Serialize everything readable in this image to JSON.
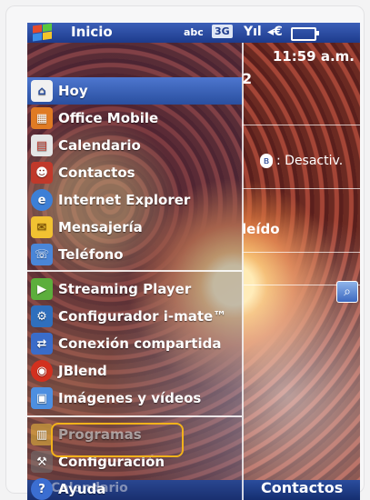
{
  "status_bar": {
    "title": "Inicio",
    "input_mode": "abc",
    "network": "3G"
  },
  "today": {
    "time": "11:59 a.m.",
    "date_fragment": "2",
    "bluetooth_status": ": Desactiv.",
    "unread_fragment": "leído"
  },
  "start_menu": {
    "group1": [
      {
        "label": "Hoy",
        "icon": "home-icon"
      },
      {
        "label": "Office Mobile",
        "icon": "office-icon"
      },
      {
        "label": "Calendario",
        "icon": "calendar-icon"
      },
      {
        "label": "Contactos",
        "icon": "contacts-icon"
      },
      {
        "label": "Internet Explorer",
        "icon": "internet-explorer-icon"
      },
      {
        "label": "Mensajería",
        "icon": "messaging-icon"
      },
      {
        "label": "Teléfono",
        "icon": "phone-icon"
      }
    ],
    "group2": [
      {
        "label": "Streaming Player",
        "icon": "streaming-player-icon"
      },
      {
        "label": "Configurador i-mate™",
        "icon": "configurator-icon"
      },
      {
        "label": "Conexión compartida",
        "icon": "shared-connection-icon"
      },
      {
        "label": "JBlend",
        "icon": "jblend-icon"
      },
      {
        "label": "Imágenes y vídeos",
        "icon": "pictures-videos-icon"
      }
    ],
    "group3": [
      {
        "label": "Programas",
        "icon": "programs-icon"
      },
      {
        "label": "Configuración",
        "icon": "settings-icon"
      },
      {
        "label": "Ayuda",
        "icon": "help-icon"
      }
    ]
  },
  "softkeys": {
    "left": "Calendario",
    "right": "Contactos"
  },
  "colors": {
    "highlight": "#f2b21b",
    "title_bar": "#1d3b8c"
  }
}
